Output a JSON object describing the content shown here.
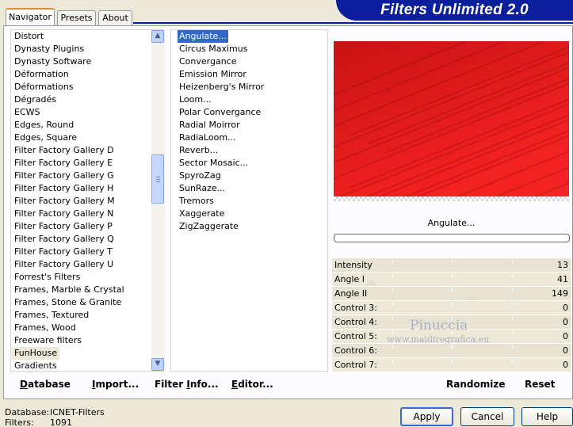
{
  "app": {
    "title": "Filters Unlimited 2.0"
  },
  "tabs": [
    {
      "label": "Navigator",
      "active": true
    },
    {
      "label": "Presets",
      "active": false
    },
    {
      "label": "About",
      "active": false
    }
  ],
  "categories": {
    "items": [
      "Distort",
      "Dynasty Plugins",
      "Dynasty Software",
      "Déformation",
      "Déformations",
      "Dégradés",
      "ECWS",
      "Edges, Round",
      "Edges, Square",
      "Filter Factory Gallery D",
      "Filter Factory Gallery E",
      "Filter Factory Gallery G",
      "Filter Factory Gallery H",
      "Filter Factory Gallery M",
      "Filter Factory Gallery N",
      "Filter Factory Gallery P",
      "Filter Factory Gallery Q",
      "Filter Factory Gallery T",
      "Filter Factory Gallery U",
      "Forrest's Filters",
      "Frames, Marble & Crystal",
      "Frames, Stone & Granite",
      "Frames, Textured",
      "Frames, Wood",
      "Freeware filters",
      "FunHouse",
      "Gradients"
    ],
    "selected": "FunHouse",
    "scroll_up": "▲",
    "scroll_down": "▼"
  },
  "filters": {
    "items": [
      "Angulate...",
      "Circus Maximus",
      "Convergance",
      "Emission Mirror",
      "Heizenberg's Mirror",
      "Loom...",
      "Polar Convergance",
      "Radial Moirror",
      "RadiaLoom...",
      "Reverb...",
      "Sector Mosaic...",
      "SpyroZag",
      "SunRaze...",
      "Tremors",
      "Xaggerate",
      "ZigZaggerate"
    ],
    "selected": "Angulate..."
  },
  "preview": {
    "filter_name": "Angulate...",
    "progress": 0,
    "fill_color": "#e31b1b"
  },
  "parameters": [
    {
      "label": "Intensity",
      "value": "13",
      "level": 13
    },
    {
      "label": "Angle I",
      "value": "41",
      "level": 41
    },
    {
      "label": "Angle II",
      "value": "149",
      "level": 149
    },
    {
      "label": "Control 3:",
      "value": "0",
      "level": 0
    },
    {
      "label": "Control 4:",
      "value": "0",
      "level": 0
    },
    {
      "label": "Control 5:",
      "value": "0",
      "level": 0
    },
    {
      "label": "Control 6:",
      "value": "0",
      "level": 0
    },
    {
      "label": "Control 7:",
      "value": "0",
      "level": 0
    }
  ],
  "parameter_range": [
    0,
    255
  ],
  "watermark": {
    "line1": "Pinuccia",
    "line2": "www.maidiregrafica.eu"
  },
  "links": {
    "database": {
      "first": "D",
      "rest": "atabase"
    },
    "import": {
      "first": "I",
      "rest": "mport..."
    },
    "filter_info": {
      "before": "Filter ",
      "first": "I",
      "rest": "nfo..."
    },
    "editor": {
      "first": "E",
      "rest": "ditor..."
    },
    "randomize": "Randomize",
    "reset": "Reset"
  },
  "status": {
    "database_label": "Database:",
    "database_value": "ICNET-Filters",
    "filters_label": "Filters:",
    "filters_value": "1091"
  },
  "buttons": {
    "apply": "Apply",
    "cancel": "Cancel",
    "help": "Help"
  },
  "colors": {
    "banner": "#0b1e9c",
    "selection": "#316ac5",
    "preview_red": "#e31b1b",
    "window": "#ece9d8"
  }
}
